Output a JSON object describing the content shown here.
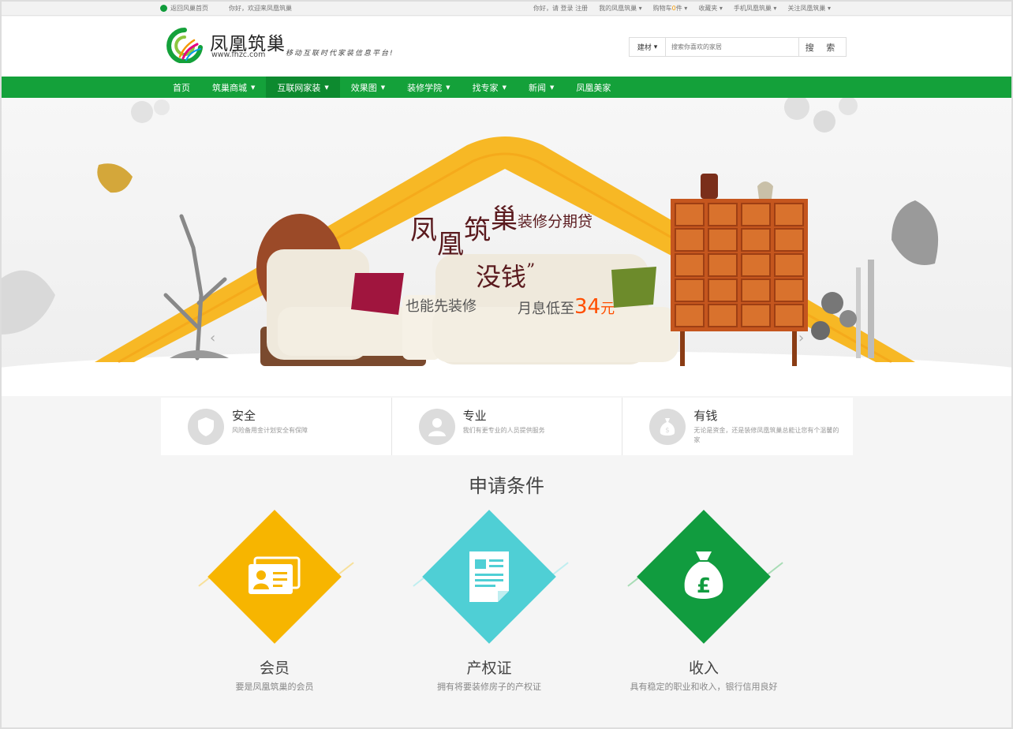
{
  "topbar": {
    "home_link": "返回风巢首页",
    "welcome": "你好，欢迎来凤凰筑巢",
    "greeting": "你好，请",
    "login": "登录",
    "register": "注册",
    "my_account": "我的凤凰筑巢",
    "cart_prefix": "购物车",
    "cart_count": "0",
    "cart_suffix": "件",
    "favorites": "收藏夹",
    "mobile": "手机凤凰筑巢",
    "follow": "关注凤凰筑巢"
  },
  "header": {
    "logo_title": "凤凰筑巢",
    "logo_url": "www.fhzc.com",
    "slogan": "移动互联时代家装信息平台!",
    "search": {
      "category": "建材",
      "placeholder": "搜索你喜欢的家居",
      "button": "搜 索"
    }
  },
  "nav": {
    "items": [
      {
        "label": "首页",
        "dropdown": false,
        "active": false
      },
      {
        "label": "筑巢商城",
        "dropdown": true,
        "active": false
      },
      {
        "label": "互联网家装",
        "dropdown": true,
        "active": true
      },
      {
        "label": "效果图",
        "dropdown": true,
        "active": false
      },
      {
        "label": "装修学院",
        "dropdown": true,
        "active": false
      },
      {
        "label": "找专家",
        "dropdown": true,
        "active": false
      },
      {
        "label": "新闻",
        "dropdown": true,
        "active": false
      },
      {
        "label": "凤凰美家",
        "dropdown": false,
        "active": false
      }
    ]
  },
  "banner": {
    "brand_chars": [
      "凤",
      "凰",
      "筑",
      "巢"
    ],
    "product": "装修分期贷",
    "headline": "没钱",
    "headline_mark": "”",
    "sub_left": "也能先装修",
    "sub_right_prefix": "月息低至",
    "rate": "34",
    "rate_unit": "元",
    "prev": "‹",
    "next": "›"
  },
  "features": [
    {
      "title": "安全",
      "desc": "风险备用金计划安全有保障",
      "icon": "shield-icon"
    },
    {
      "title": "专业",
      "desc": "我们有更专业的人员提供服务",
      "icon": "user-icon"
    },
    {
      "title": "有钱",
      "desc": "无论是资金，还是装修凤凰筑巢总能让您有个温馨的家",
      "icon": "money-bag-icon"
    }
  ],
  "conditions": {
    "title": "申请条件",
    "items": [
      {
        "name": "会员",
        "desc": "要是凤凰筑巢的会员",
        "icon": "id-card-icon",
        "color": "#f7b500"
      },
      {
        "name": "产权证",
        "desc": "拥有将要装修房子的产权证",
        "icon": "document-icon",
        "color": "#4fcfd5"
      },
      {
        "name": "收入",
        "desc": "具有稳定的职业和收入，银行信用良好",
        "icon": "pound-bag-icon",
        "color": "#119c3f"
      }
    ]
  },
  "colors": {
    "brand_green": "#14a13a",
    "nav_active": "#0d8a2f",
    "accent_orange": "#ff4e00",
    "banner_roof": "#f7b825"
  }
}
